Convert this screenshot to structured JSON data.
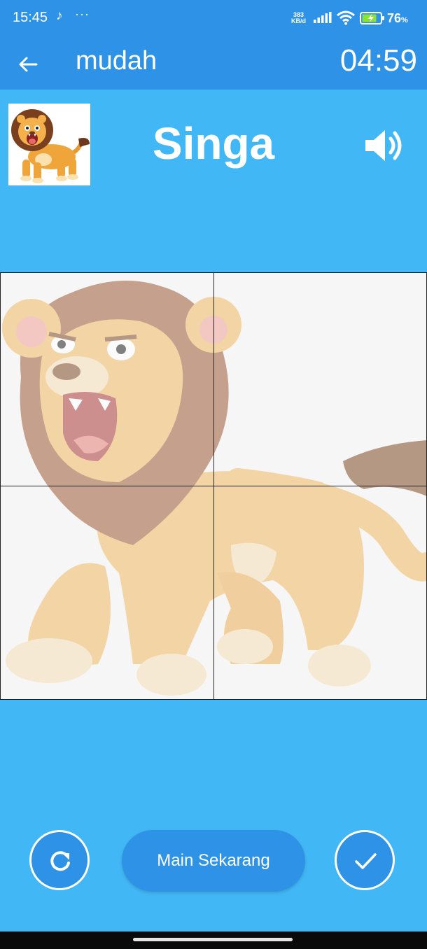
{
  "status_bar": {
    "time": "15:45",
    "tiktok_icon": "♪",
    "dots": "···",
    "speed_value": "383",
    "speed_unit": "KB/d",
    "battery_level": "76",
    "battery_unit": "%"
  },
  "app_bar": {
    "title": "mudah",
    "timer": "04:59",
    "back_icon": "arrow-left-icon"
  },
  "puzzle": {
    "word": "Singa",
    "thumbnail": "lion-thumbnail",
    "sound_icon": "speaker-icon",
    "tiles": [
      "tile-1",
      "tile-2",
      "tile-3",
      "tile-4"
    ]
  },
  "controls": {
    "reset_icon": "refresh-icon",
    "play_label": "Main Sekarang",
    "check_icon": "check-icon"
  },
  "colors": {
    "app_bar": "#2e93e6",
    "background": "#42b7f5",
    "button": "#2e93e6"
  }
}
